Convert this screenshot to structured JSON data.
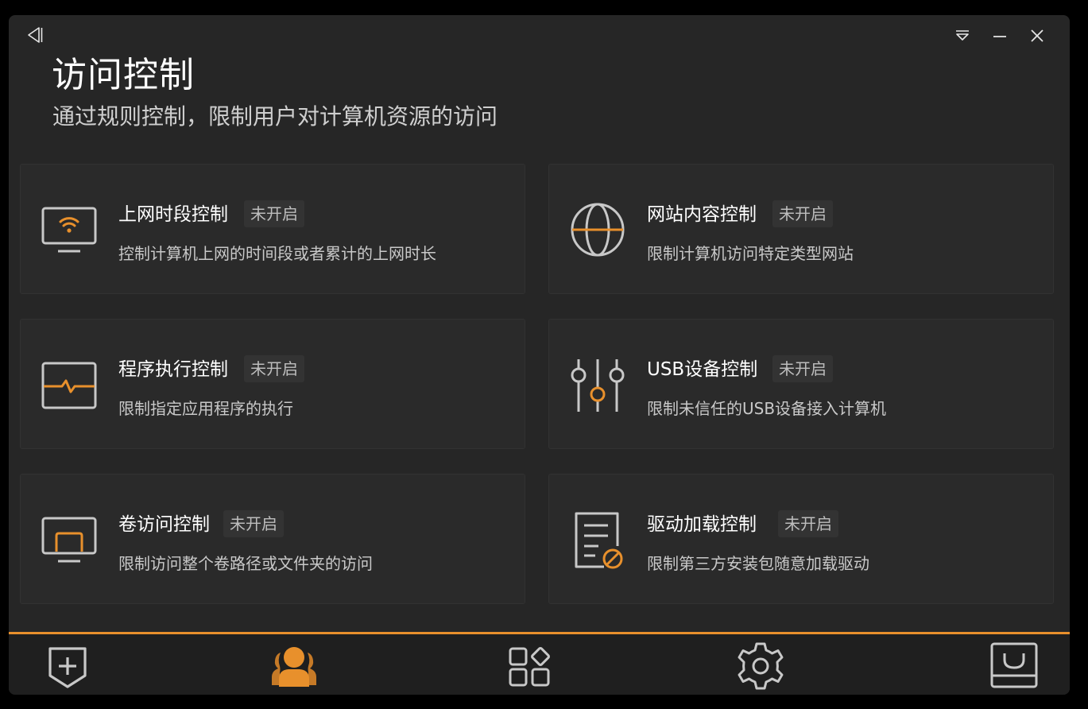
{
  "window": {
    "title": "访问控制",
    "subtitle": "通过规则控制，限制用户对计算机资源的访问"
  },
  "controls": {
    "back_icon": "collapse-left-icon",
    "dropdown_icon": "dropdown-triangle-icon",
    "minimize_icon": "minimize-icon",
    "close_icon": "close-icon"
  },
  "cards": [
    {
      "title": "上网时段控制",
      "status": "未开启",
      "description": "控制计算机上网的时间段或者累计的上网时长",
      "icon": "monitor-wifi-icon"
    },
    {
      "title": "网站内容控制",
      "status": "未开启",
      "description": "限制计算机访问特定类型网站",
      "icon": "globe-icon"
    },
    {
      "title": "程序执行控制",
      "status": "未开启",
      "description": "限制指定应用程序的执行",
      "icon": "monitor-pulse-icon"
    },
    {
      "title": "USB设备控制",
      "status": "未开启",
      "description": "限制未信任的USB设备接入计算机",
      "icon": "sliders-icon"
    },
    {
      "title": "卷访问控制",
      "status": "未开启",
      "description": "限制访问整个卷路径或文件夹的访问",
      "icon": "monitor-folder-icon"
    },
    {
      "title": "驱动加载控制",
      "status": "未开启",
      "description": "限制第三方安装包随意加载驱动",
      "icon": "document-forbidden-icon"
    }
  ],
  "bottom_nav": [
    {
      "name": "shield-plus-icon",
      "active": false
    },
    {
      "name": "users-icon",
      "active": true
    },
    {
      "name": "apps-grid-icon",
      "active": false
    },
    {
      "name": "settings-gear-icon",
      "active": false
    },
    {
      "name": "inbox-tray-icon",
      "active": false
    }
  ],
  "colors": {
    "accent": "#e8902c",
    "background": "#262626",
    "card": "#2a2a2a",
    "icon_gray": "#c8c8c8"
  }
}
